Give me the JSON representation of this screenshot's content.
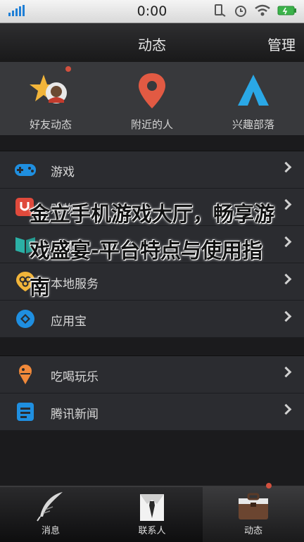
{
  "status_bar": {
    "time": "0:00"
  },
  "header": {
    "title": "动态",
    "manage_label": "管理"
  },
  "quick_actions": [
    {
      "label": "好友动态",
      "icon": "star-avatar-icon"
    },
    {
      "label": "附近的人",
      "icon": "location-pin-icon"
    },
    {
      "label": "兴趣部落",
      "icon": "tent-icon"
    }
  ],
  "menu_group_1": [
    {
      "label": "游戏",
      "icon": "gamepad-icon"
    },
    {
      "label": "购物",
      "icon": "shopping-bag-icon"
    },
    {
      "label": "阅读",
      "icon": "book-icon"
    },
    {
      "label": "本地服务",
      "icon": "local-service-icon"
    },
    {
      "label": "应用宝",
      "icon": "app-store-icon"
    }
  ],
  "menu_group_2": [
    {
      "label": "吃喝玩乐",
      "icon": "ice-cream-icon"
    },
    {
      "label": "腾讯新闻",
      "icon": "news-icon"
    }
  ],
  "overlay": {
    "text": "金立手机游戏大厅，畅享游戏盛宴-平台特点与使用指南"
  },
  "tabs": [
    {
      "label": "消息",
      "icon": "feather-icon"
    },
    {
      "label": "联系人",
      "icon": "contacts-icon"
    },
    {
      "label": "动态",
      "icon": "briefcase-icon"
    }
  ],
  "colors": {
    "accent_blue": "#1f7fd6",
    "orange": "#f0893a",
    "notification": "#d2503e"
  }
}
